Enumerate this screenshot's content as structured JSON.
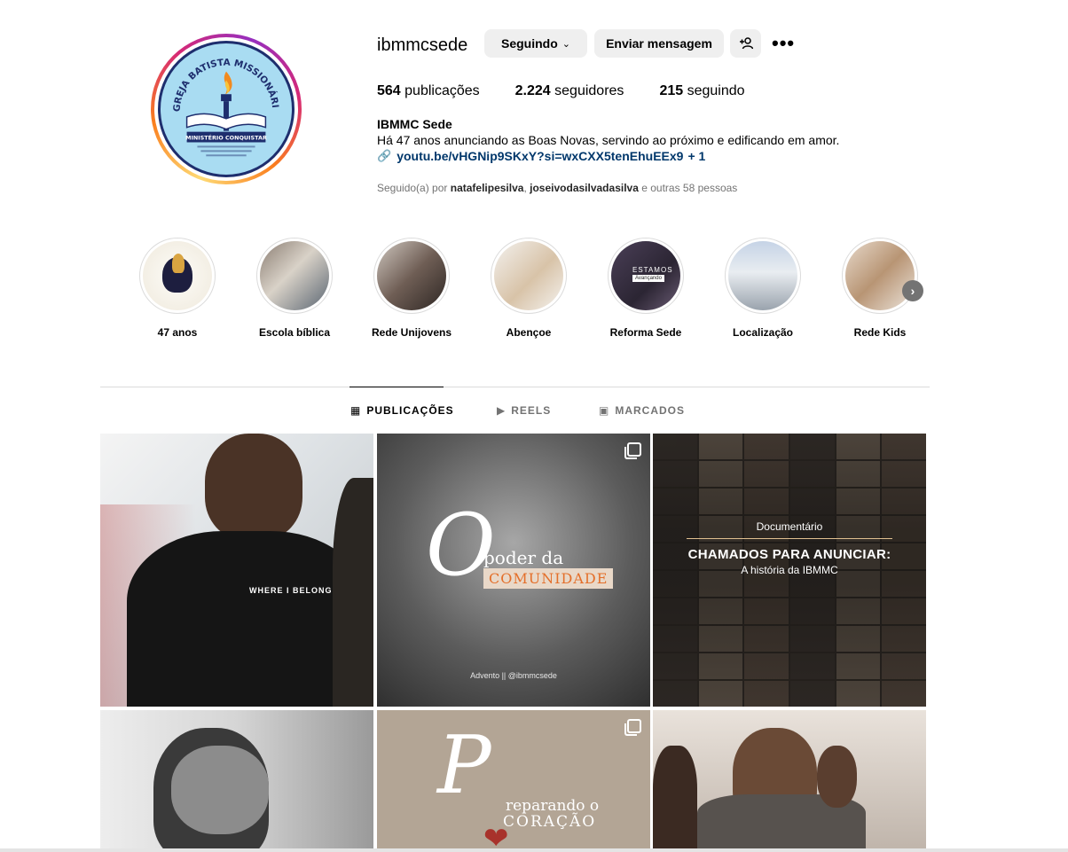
{
  "profile": {
    "username": "ibmmcsede",
    "following_label": "Seguindo",
    "message_label": "Enviar mensagem",
    "stats": {
      "posts_count": "564",
      "posts_label": "publicações",
      "followers_count": "2.224",
      "followers_label": "seguidores",
      "following_count": "215",
      "following_label": "seguindo"
    },
    "full_name": "IBMMC Sede",
    "bio": "Há 47 anos anunciando as Boas Novas, servindo ao próximo e edificando em amor.",
    "link": "youtu.be/vHGNip9SKxY?si=wxCXX5tenEhuEEx9",
    "link_extra": "+ 1",
    "followed_by_prefix": "Seguido(a) por",
    "followed_by_user1": "natafelipesilva",
    "followed_by_sep": ",",
    "followed_by_user2": "joseivodasilvadasilva",
    "followed_by_suffix": "e outras 58 pessoas",
    "avatar_text_top": "IGREJA BATISTA MISSIONÁRIA",
    "avatar_text_bottom": "MINISTÉRIO CONQUISTAR"
  },
  "highlights": [
    {
      "label": "47 anos"
    },
    {
      "label": "Escola bíblica"
    },
    {
      "label": "Rede Unijovens"
    },
    {
      "label": "Abençoe"
    },
    {
      "label": "Reforma Sede"
    },
    {
      "label": "Localização"
    },
    {
      "label": "Rede Kids"
    }
  ],
  "highlight_overlay_text": "ESTAMOS",
  "highlight_overlay_sub": "Avançando",
  "tabs": {
    "posts": "PUBLICAÇÕES",
    "reels": "REELS",
    "tagged": "MARCADOS"
  },
  "posts": {
    "p1_shirt": "WHERE I BELONG",
    "p2_line1": "poder da",
    "p2_line2": "COMUNIDADE",
    "p2_footer": "Advento || @ibmmcsede",
    "p3_label": "Documentário",
    "p3_title": "CHAMADOS PARA ANUNCIAR:",
    "p3_sub": "A história da IBMMC",
    "p5_line1": "reparando o",
    "p5_line2": "CORAÇÃO"
  },
  "icons": {
    "chevron": "chevron-down-icon",
    "add_user": "add-user-icon",
    "more": "more-options-icon",
    "link": "link-icon",
    "grid": "grid-icon",
    "reels": "reels-icon",
    "tagged": "tagged-icon",
    "multi": "carousel-icon"
  },
  "colors": {
    "link": "#00376b",
    "button_bg": "#efefef",
    "muted": "#737373"
  }
}
